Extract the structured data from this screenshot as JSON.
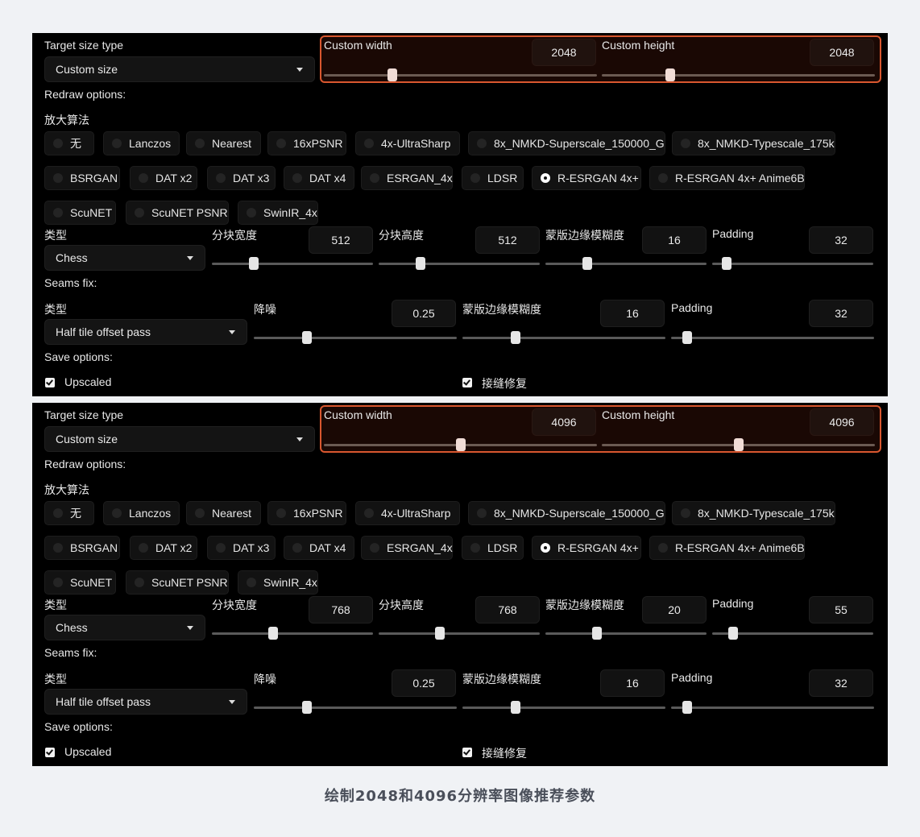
{
  "caption": "绘制2048和4096分辨率图像推荐参数",
  "labels": {
    "target_size_type": "Target size type",
    "custom_width": "Custom width",
    "custom_height": "Custom height",
    "redraw_options": "Redraw options:",
    "upscaler": "放大算法",
    "type": "类型",
    "tile_width": "分块宽度",
    "tile_height": "分块高度",
    "mask_blur": "蒙版边缘模糊度",
    "padding": "Padding",
    "seams_fix": "Seams fix:",
    "denoise": "降噪",
    "save_options": "Save options:",
    "upscaled": "Upscaled",
    "seams_fix_save": "接缝修复"
  },
  "upscalers": [
    "无",
    "Lanczos",
    "Nearest",
    "16xPSNR",
    "4x-UltraSharp",
    "8x_NMKD-Superscale_150000_G",
    "8x_NMKD-Typescale_175k",
    "BSRGAN",
    "DAT x2",
    "DAT x3",
    "DAT x4",
    "ESRGAN_4x",
    "LDSR",
    "R-ESRGAN 4x+",
    "R-ESRGAN 4x+ Anime6B",
    "ScuNET",
    "ScuNET PSNR",
    "SwinIR_4x"
  ],
  "accent_color": "#d9572f",
  "panels": [
    {
      "target_size_type": "Custom size",
      "custom_width": {
        "value": "2048",
        "fraction": 0.25
      },
      "custom_height": {
        "value": "2048",
        "fraction": 0.25
      },
      "selected_upscaler": "R-ESRGAN 4x+",
      "redraw_type": "Chess",
      "tile_width": {
        "value": "512",
        "fraction": 0.26
      },
      "tile_height": {
        "value": "512",
        "fraction": 0.26
      },
      "mask_blur": {
        "value": "16",
        "fraction": 0.26
      },
      "padding": {
        "value": "32",
        "fraction": 0.09
      },
      "seams_type": "Half tile offset pass",
      "seams_denoise": {
        "value": "0.25",
        "fraction": 0.26
      },
      "seams_mask_blur": {
        "value": "16",
        "fraction": 0.26
      },
      "seams_padding": {
        "value": "32",
        "fraction": 0.08
      },
      "save_upscaled": true,
      "save_seams_fix": true
    },
    {
      "target_size_type": "Custom size",
      "custom_width": {
        "value": "4096",
        "fraction": 0.5
      },
      "custom_height": {
        "value": "4096",
        "fraction": 0.5
      },
      "selected_upscaler": "R-ESRGAN 4x+",
      "redraw_type": "Chess",
      "tile_width": {
        "value": "768",
        "fraction": 0.38
      },
      "tile_height": {
        "value": "768",
        "fraction": 0.38
      },
      "mask_blur": {
        "value": "20",
        "fraction": 0.32
      },
      "padding": {
        "value": "55",
        "fraction": 0.13
      },
      "seams_type": "Half tile offset pass",
      "seams_denoise": {
        "value": "0.25",
        "fraction": 0.26
      },
      "seams_mask_blur": {
        "value": "16",
        "fraction": 0.26
      },
      "seams_padding": {
        "value": "32",
        "fraction": 0.08
      },
      "save_upscaled": true,
      "save_seams_fix": true
    }
  ]
}
